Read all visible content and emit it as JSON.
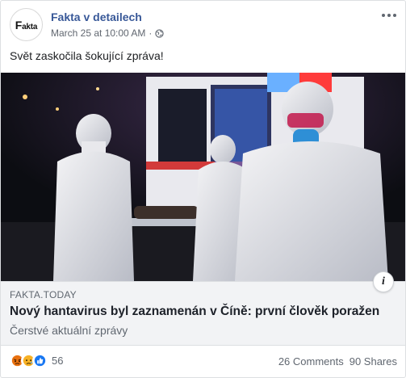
{
  "post": {
    "page_name": "Fakta v detailech",
    "timestamp": "March 25 at 10:00 AM",
    "separator": "·",
    "privacy_icon": "globe-icon",
    "text": "Svět zaskočila šokující zpráva!",
    "avatar_logo_big": "F",
    "avatar_logo_rest": "akta"
  },
  "link_preview": {
    "domain": "FAKTA.TODAY",
    "title": "Nový hantavirus byl zaznamenán v Číně: první člověk poražen",
    "description": "Čerstvé aktuální zprávy",
    "info_label": "i"
  },
  "footer": {
    "reaction_icons": [
      "angry-icon",
      "sad-icon",
      "like-icon"
    ],
    "reaction_count": "56",
    "comments": "26 Comments",
    "shares": "90 Shares"
  },
  "colors": {
    "page_name": "#385898",
    "link_box_bg": "#f2f3f5",
    "like_blue": "#1877f2",
    "angry_orange": "#e9710f",
    "sad_yellow": "#f7b125"
  }
}
